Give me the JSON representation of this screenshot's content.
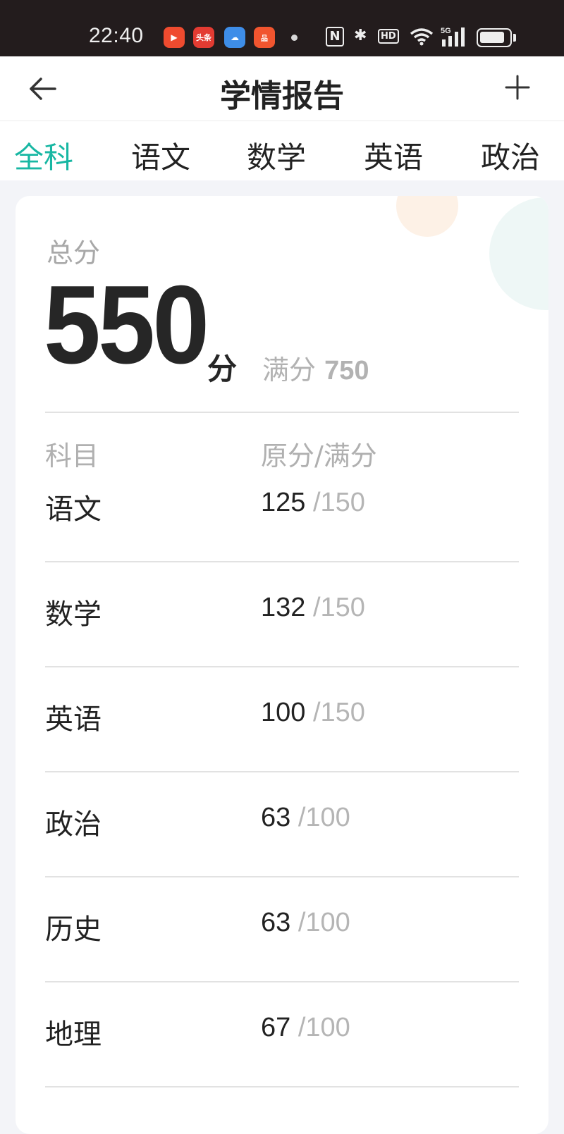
{
  "status_bar": {
    "time": "22:40",
    "apps": [
      {
        "name": "video-app-icon",
        "glyph": "▶",
        "color": "#ef4b2f"
      },
      {
        "name": "toutiao-app-icon",
        "glyph": "头条",
        "color": "#e33b32"
      },
      {
        "name": "weather-app-icon",
        "glyph": "☁",
        "color": "#3e8de8"
      },
      {
        "name": "store-app-icon",
        "glyph": "品",
        "color": "#f1552f"
      }
    ],
    "nfc": "N",
    "hd": "HD",
    "network": "5G",
    "battery_level": 0.85
  },
  "header": {
    "title": "学情报告",
    "back_icon": "arrow-left",
    "add_icon": "plus"
  },
  "tabs": [
    {
      "label": "全科",
      "active": true
    },
    {
      "label": "语文",
      "active": false
    },
    {
      "label": "数学",
      "active": false
    },
    {
      "label": "英语",
      "active": false
    },
    {
      "label": "政治",
      "active": false
    }
  ],
  "summary": {
    "label": "总分",
    "score": "550",
    "unit": "分",
    "full_label": "满分",
    "full_value": "750"
  },
  "table": {
    "col_subject": "科目",
    "col_score": "原分/满分",
    "rows": [
      {
        "subject": "语文",
        "score": "125",
        "full": "/150"
      },
      {
        "subject": "数学",
        "score": "132",
        "full": "/150"
      },
      {
        "subject": "英语",
        "score": "100",
        "full": "/150"
      },
      {
        "subject": "政治",
        "score": "63",
        "full": "/100"
      },
      {
        "subject": "历史",
        "score": "63",
        "full": "/100"
      },
      {
        "subject": "地理",
        "score": "67",
        "full": "/100"
      }
    ]
  },
  "colors": {
    "accent": "#18b7a3",
    "status_bar": "#231c1d",
    "background": "#f3f4f8"
  }
}
